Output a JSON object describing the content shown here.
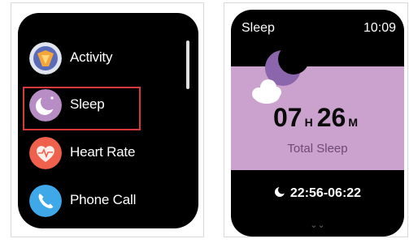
{
  "menu": {
    "items": [
      {
        "label": "Activity",
        "icon": "activity-icon"
      },
      {
        "label": "Sleep",
        "icon": "sleep-icon",
        "highlighted": true
      },
      {
        "label": "Heart Rate",
        "icon": "heart-rate-icon"
      },
      {
        "label": "Phone Call",
        "icon": "phone-call-icon"
      }
    ],
    "highlight_color": "#d8383b"
  },
  "sleep_screen": {
    "title": "Sleep",
    "time": "10:09",
    "hours": "07",
    "hours_unit": "H",
    "minutes": "26",
    "minutes_unit": "M",
    "caption": "Total Sleep",
    "range": "22:56-06:22",
    "card_color": "#caa2cd",
    "accent_color": "#8b66ad"
  }
}
